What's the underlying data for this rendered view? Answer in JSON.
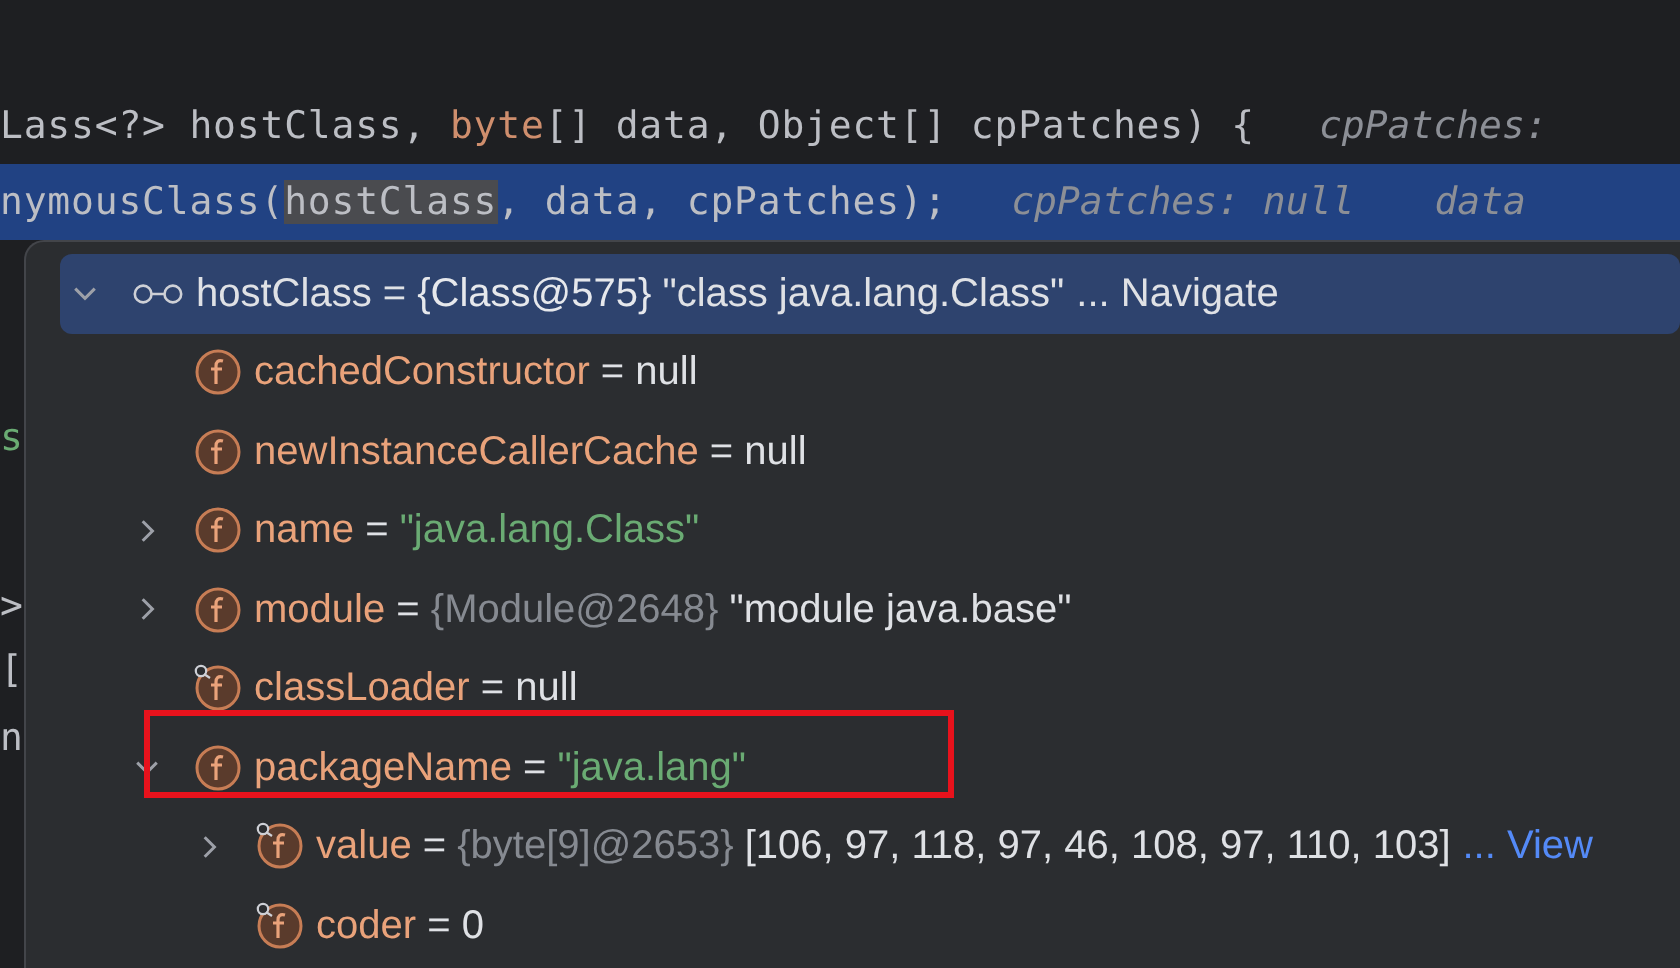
{
  "editor": {
    "lines": [
      {
        "code": [
          {
            "text": "Lass<?> hostClass, ",
            "kind": "plain"
          },
          {
            "text": "byte",
            "kind": "keyword"
          },
          {
            "text": "[] data, Object[] cpPatches) {",
            "kind": "plain"
          }
        ],
        "hints": [
          "cpPatches:"
        ],
        "selected": false
      },
      {
        "code": [
          {
            "text": "nymousClass(",
            "kind": "plain"
          },
          {
            "text": "hostClass",
            "kind": "usage"
          },
          {
            "text": ", data, cpPatches);",
            "kind": "plain"
          }
        ],
        "hints": [
          "cpPatches: null",
          "data"
        ],
        "selected": true
      }
    ],
    "fragments": [
      {
        "text": "s",
        "kind": "string"
      },
      {
        "text": ">",
        "kind": "plain"
      },
      {
        "text": "[",
        "kind": "plain"
      },
      {
        "text": "n",
        "kind": "plain"
      }
    ]
  },
  "variables": [
    {
      "kind": "watch",
      "name": "hostClass",
      "expanded": true,
      "selected": true,
      "value": [
        {
          "text": " = ",
          "kind": "plain"
        },
        {
          "text": "{Class@575}",
          "kind": "ref"
        },
        {
          "text": " \"class java.lang.Class\"",
          "kind": "plain"
        }
      ],
      "link": "... Navigate",
      "children": [
        {
          "kind": "field",
          "name": "cachedConstructor",
          "value": [
            {
              "text": " = null",
              "kind": "plain"
            }
          ]
        },
        {
          "kind": "field",
          "name": "newInstanceCallerCache",
          "value": [
            {
              "text": " = null",
              "kind": "plain"
            }
          ]
        },
        {
          "kind": "field",
          "name": "name",
          "expanded": false,
          "value": [
            {
              "text": " = ",
              "kind": "plain"
            },
            {
              "text": "\"java.lang.Class\"",
              "kind": "string"
            }
          ]
        },
        {
          "kind": "field",
          "name": "module",
          "expanded": false,
          "value": [
            {
              "text": " = ",
              "kind": "plain"
            },
            {
              "text": "{Module@2648}",
              "kind": "ref"
            },
            {
              "text": " \"module java.base\"",
              "kind": "plain"
            }
          ]
        },
        {
          "kind": "final-field",
          "name": "classLoader",
          "value": [
            {
              "text": " = null",
              "kind": "plain"
            }
          ]
        },
        {
          "kind": "field",
          "name": "packageName",
          "expanded": true,
          "highlighted": true,
          "value": [
            {
              "text": " = ",
              "kind": "plain"
            },
            {
              "text": "\"java.lang\"",
              "kind": "string"
            }
          ],
          "children": [
            {
              "kind": "final-field",
              "name": "value",
              "expanded": false,
              "value": [
                {
                  "text": " = ",
                  "kind": "plain"
                },
                {
                  "text": "{byte[9]@2653}",
                  "kind": "ref"
                },
                {
                  "text": " [106, 97, 118, 97, 46, 108, 97, 110, 103]",
                  "kind": "plain"
                }
              ],
              "link": "... View"
            },
            {
              "kind": "final-field",
              "name": "coder",
              "value": [
                {
                  "text": " = 0",
                  "kind": "plain"
                }
              ]
            }
          ]
        }
      ]
    }
  ]
}
